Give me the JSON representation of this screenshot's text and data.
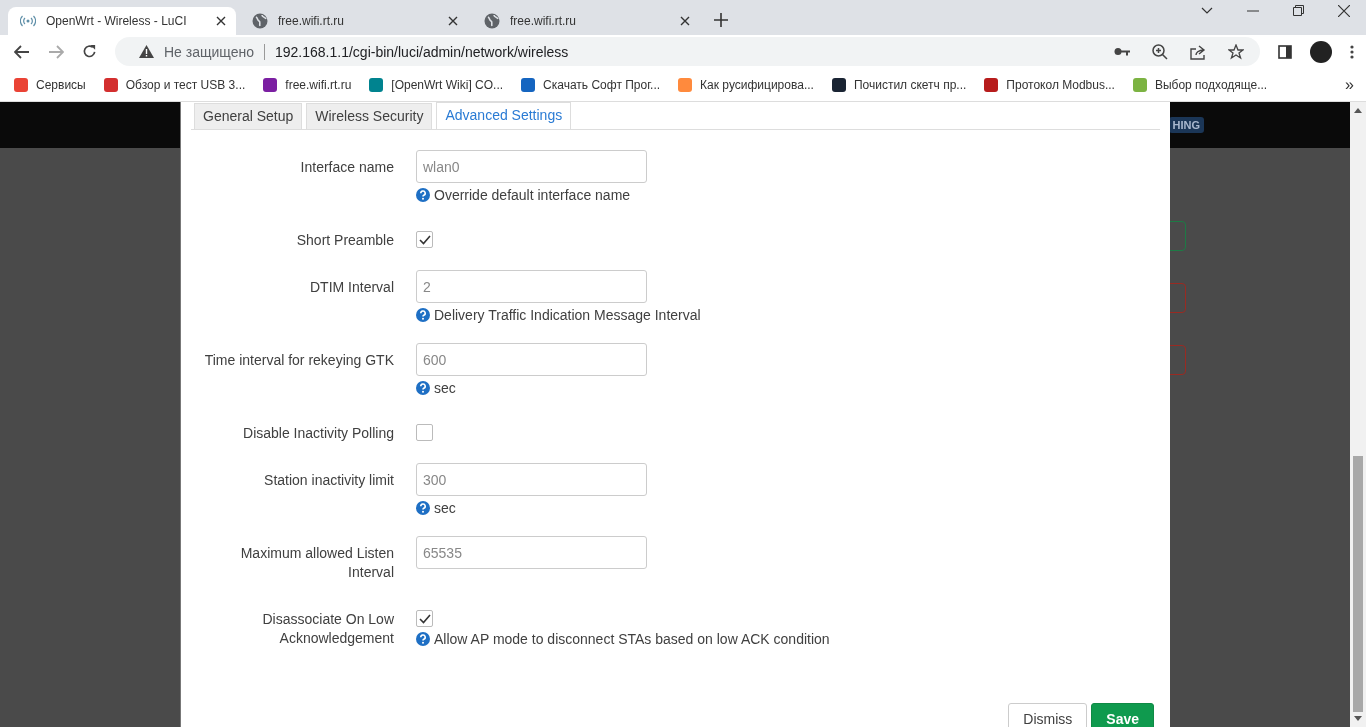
{
  "browser": {
    "tabs": [
      {
        "title": "OpenWrt - Wireless - LuCI",
        "selected": true
      },
      {
        "title": "free.wifi.rt.ru",
        "selected": false
      },
      {
        "title": "free.wifi.rt.ru",
        "selected": false
      }
    ],
    "security": "Не защищено",
    "url": "192.168.1.1/cgi-bin/luci/admin/network/wireless",
    "bookmarks": [
      {
        "title": "Сервисы",
        "color": "#ea4335"
      },
      {
        "title": "Обзор и тест USB 3...",
        "color": "#d32f2f"
      },
      {
        "title": "free.wifi.rt.ru",
        "color": "#7b1fa2"
      },
      {
        "title": "[OpenWrt Wiki] CO...",
        "color": "#00838f"
      },
      {
        "title": "Скачать Софт Прог...",
        "color": "#1565c0"
      },
      {
        "title": "Как русифицирова...",
        "color": "#ff8a3d"
      },
      {
        "title": "Почистил скетч пр...",
        "color": "#1a2433"
      },
      {
        "title": "Протокол Modbus...",
        "color": "#b71c1c"
      },
      {
        "title": "Выбор подходяще...",
        "color": "#7cb342"
      }
    ],
    "more": "»"
  },
  "background": {
    "badge": "HING"
  },
  "modal": {
    "tabs": [
      {
        "label": "General Setup",
        "selected": false
      },
      {
        "label": "Wireless Security",
        "selected": false
      },
      {
        "label": "Advanced Settings",
        "selected": true
      }
    ],
    "fields": [
      {
        "kind": "text",
        "label": "Interface name",
        "placeholder": "wlan0",
        "hint": "Override default interface name"
      },
      {
        "kind": "checkbox",
        "label": "Short Preamble",
        "checked": true
      },
      {
        "kind": "text",
        "label": "DTIM Interval",
        "placeholder": "2",
        "hint": "Delivery Traffic Indication Message Interval"
      },
      {
        "kind": "text",
        "label": "Time interval for rekeying GTK",
        "placeholder": "600",
        "hint": "sec"
      },
      {
        "kind": "checkbox",
        "label": "Disable Inactivity Polling",
        "checked": false
      },
      {
        "kind": "text",
        "label": "Station inactivity limit",
        "placeholder": "300",
        "hint": "sec"
      },
      {
        "kind": "text",
        "label": "Maximum allowed Listen Interval",
        "placeholder": "65535"
      },
      {
        "kind": "checkbox",
        "label": "Disassociate On Low Acknowledgement",
        "checked": true,
        "hint": "Allow AP mode to disconnect STAs based on low ACK condition"
      }
    ],
    "buttons": [
      {
        "label": "Dismiss",
        "kind": "default"
      },
      {
        "label": "Save",
        "kind": "primary"
      }
    ]
  }
}
